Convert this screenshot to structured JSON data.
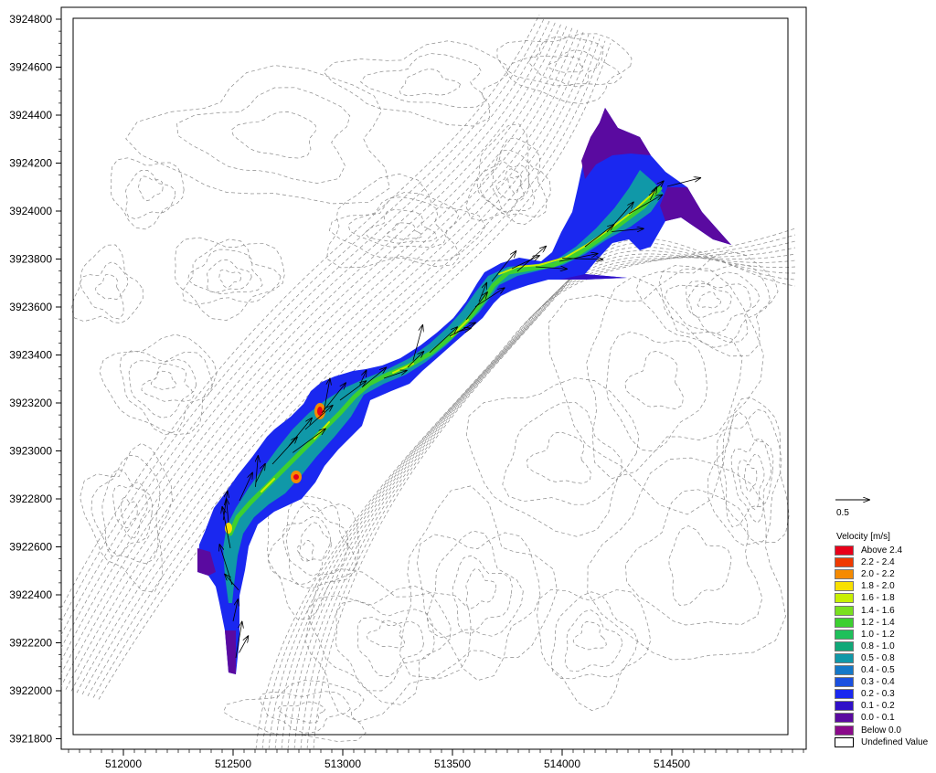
{
  "map": {
    "y_axis_ticks": [
      "3924800",
      "3924600",
      "3924400",
      "3924200",
      "3924000",
      "3923800",
      "3923600",
      "3923400",
      "3923200",
      "3923000",
      "3922800",
      "3922600",
      "3922400",
      "3922200",
      "3922000",
      "3921800"
    ],
    "x_axis_ticks": [
      "512000",
      "512500",
      "513000",
      "513500",
      "514000",
      "514500"
    ],
    "x_range": [
      511750,
      514800
    ],
    "y_range": [
      3921780,
      3924830
    ]
  },
  "vector_scale": {
    "label": "0.5"
  },
  "legend": {
    "title": "Velocity [m/s]",
    "items": [
      {
        "label": "Above 2.4",
        "color": "#e8001a"
      },
      {
        "label": "2.2 - 2.4",
        "color": "#f03a00"
      },
      {
        "label": "2.0 - 2.2",
        "color": "#f58a00"
      },
      {
        "label": "1.8 - 2.0",
        "color": "#f8e000"
      },
      {
        "label": "1.6 - 1.8",
        "color": "#c8f000"
      },
      {
        "label": "1.4 - 1.6",
        "color": "#7ae020"
      },
      {
        "label": "1.2 - 1.4",
        "color": "#3cd030"
      },
      {
        "label": "1.0 - 1.2",
        "color": "#1ec05a"
      },
      {
        "label": "0.8 - 1.0",
        "color": "#10a878"
      },
      {
        "label": "0.5 - 0.8",
        "color": "#1098a8"
      },
      {
        "label": "0.4 - 0.5",
        "color": "#1478c8"
      },
      {
        "label": "0.3 - 0.4",
        "color": "#1a50e0"
      },
      {
        "label": "0.2 - 0.3",
        "color": "#1a28f0"
      },
      {
        "label": "0.1 - 0.2",
        "color": "#3010c8"
      },
      {
        "label": "0.0 - 0.1",
        "color": "#5a0aa0"
      },
      {
        "label": "Below 0.0",
        "color": "#8a0a8a"
      },
      {
        "label": "Undefined Value",
        "color": "#ffffff"
      }
    ]
  }
}
